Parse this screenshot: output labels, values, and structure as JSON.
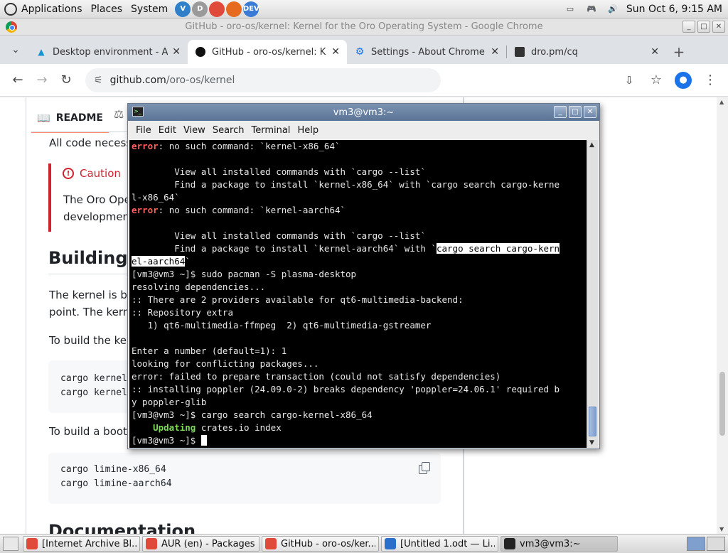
{
  "top_panel": {
    "menus": [
      "Applications",
      "Places",
      "System"
    ],
    "launchers": [
      {
        "icon": "vscode-icon",
        "text": "V",
        "color": "#2f80c9"
      },
      {
        "icon": "gedit-icon",
        "text": "D",
        "color": "#9a9a9a"
      },
      {
        "icon": "chrome-icon",
        "text": "",
        "color": "#e04a3b"
      },
      {
        "icon": "firefox-icon",
        "text": "",
        "color": "#e66a1f"
      },
      {
        "icon": "dev-icon",
        "text": "DEV",
        "color": "#3a7bd5"
      }
    ],
    "clock": "Sun Oct  6,  9:15 AM"
  },
  "chrome": {
    "window_title": "GitHub - oro-os/kernel: Kernel for the Oro Operating System - Google Chrome",
    "tabs": [
      {
        "label": "Desktop environment - Ar",
        "icon": "arch-icon",
        "active": false
      },
      {
        "label": "GitHub - oro-os/kernel: K",
        "icon": "github-icon",
        "active": true
      },
      {
        "label": "Settings - About Chrome",
        "icon": "settings-icon",
        "active": false
      },
      {
        "label": "dro.pm/cq",
        "icon": "dro-icon",
        "active": false
      }
    ],
    "url_host": "github.com",
    "url_path": "/oro-os/kernel"
  },
  "page": {
    "readme_tab": "README",
    "intro_text": "All code necess",
    "caution_title": "Caution",
    "caution_line1": "The Oro Ope",
    "caution_line2": "development",
    "building_heading": "Building",
    "building_p1": "The kernel is bu",
    "building_p2": "point. The kerne",
    "build_kernel_text": "To build the ker",
    "code1": [
      "cargo kernel",
      "cargo kernel"
    ],
    "build_boot_text": "To build a bootl",
    "code2": [
      "cargo limine-x86_64",
      "cargo limine-aarch64"
    ],
    "documentation_heading": "Documentation"
  },
  "terminal": {
    "title": "vm3@vm3:~",
    "menu": [
      "File",
      "Edit",
      "View",
      "Search",
      "Terminal",
      "Help"
    ],
    "lines": [
      {
        "err": "error",
        "text": ": no such command: `kernel-x86_64`"
      },
      {
        "text": ""
      },
      {
        "text": "        View all installed commands with `cargo --list`"
      },
      {
        "text": "        Find a package to install `kernel-x86_64` with `cargo search cargo-kerne"
      },
      {
        "text": "l-x86_64`"
      },
      {
        "err": "error",
        "text": ": no such command: `kernel-aarch64`"
      },
      {
        "text": ""
      },
      {
        "text": "        View all installed commands with `cargo --list`"
      },
      {
        "pre": "        Find a package to install `kernel-aarch64` with `",
        "hl": "cargo search cargo-kern"
      },
      {
        "hl": "el-aarch64",
        "text": "`"
      },
      {
        "text": "[vm3@vm3 ~]$ sudo pacman -S plasma-desktop"
      },
      {
        "text": "resolving dependencies..."
      },
      {
        "text": ":: There are 2 providers available for qt6-multimedia-backend:"
      },
      {
        "text": ":: Repository extra"
      },
      {
        "text": "   1) qt6-multimedia-ffmpeg  2) qt6-multimedia-gstreamer"
      },
      {
        "text": ""
      },
      {
        "text": "Enter a number (default=1): 1"
      },
      {
        "text": "looking for conflicting packages..."
      },
      {
        "text": "error: failed to prepare transaction (could not satisfy dependencies)"
      },
      {
        "text": ":: installing poppler (24.09.0-2) breaks dependency 'poppler=24.06.1' required b"
      },
      {
        "text": "y poppler-glib"
      },
      {
        "text": "[vm3@vm3 ~]$ cargo search cargo-kernel-x86_64"
      },
      {
        "upd": "    Updating",
        "text": " crates.io index"
      },
      {
        "text": "[vm3@vm3 ~]$ ",
        "cursor": true
      }
    ]
  },
  "taskbar": {
    "items": [
      {
        "label": "[Internet Archive Bl...",
        "icon": "chrome-icon",
        "active": false
      },
      {
        "label": "AUR (en) - Packages...",
        "icon": "chrome-icon",
        "active": false
      },
      {
        "label": "GitHub - oro-os/ker...",
        "icon": "chrome-icon",
        "active": false
      },
      {
        "label": "[Untitled 1.odt — Li...",
        "icon": "document-icon",
        "active": false
      },
      {
        "label": "vm3@vm3:~",
        "icon": "terminal-icon",
        "active": true
      }
    ]
  }
}
